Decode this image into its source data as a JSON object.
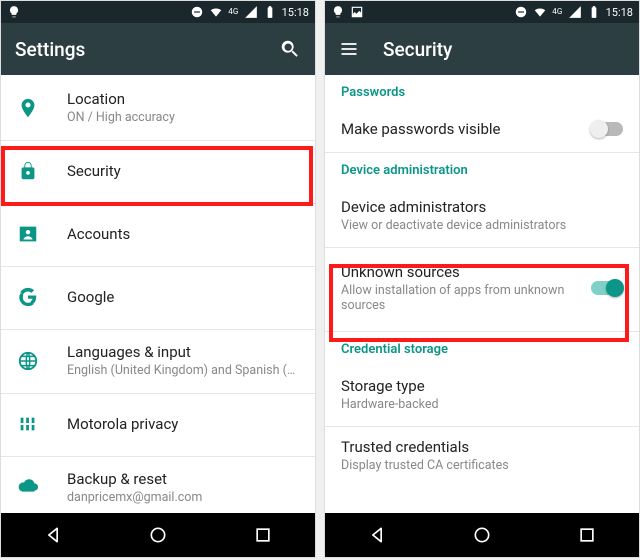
{
  "left": {
    "statusbar": {
      "time": "15:18",
      "network": "4G"
    },
    "appbar": {
      "title": "Settings"
    },
    "items": [
      {
        "title": "Location",
        "sub": "ON / High accuracy",
        "icon": "location"
      },
      {
        "title": "Security",
        "sub": "",
        "icon": "lock"
      },
      {
        "title": "Accounts",
        "sub": "",
        "icon": "account"
      },
      {
        "title": "Google",
        "sub": "",
        "icon": "google"
      },
      {
        "title": "Languages & input",
        "sub": "English (United Kingdom) and Spanish (M...",
        "icon": "globe"
      },
      {
        "title": "Motorola privacy",
        "sub": "",
        "icon": "privacy"
      },
      {
        "title": "Backup & reset",
        "sub": "danpricemx@gmail.com",
        "icon": "backup"
      }
    ]
  },
  "right": {
    "statusbar": {
      "time": "15:18",
      "network": "4G"
    },
    "appbar": {
      "title": "Security"
    },
    "sections": {
      "passwords": {
        "header": "Passwords",
        "rows": [
          {
            "title": "Make passwords visible",
            "sub": "",
            "toggle": "off"
          }
        ]
      },
      "device_admin": {
        "header": "Device administration",
        "rows": [
          {
            "title": "Device administrators",
            "sub": "View or deactivate device administrators",
            "toggle": null
          },
          {
            "title": "Unknown sources",
            "sub": "Allow installation of apps from unknown sources",
            "toggle": "on"
          }
        ]
      },
      "cred": {
        "header": "Credential storage",
        "rows": [
          {
            "title": "Storage type",
            "sub": "Hardware-backed",
            "toggle": null
          },
          {
            "title": "Trusted credentials",
            "sub": "Display trusted CA certificates",
            "toggle": null
          }
        ]
      }
    }
  }
}
